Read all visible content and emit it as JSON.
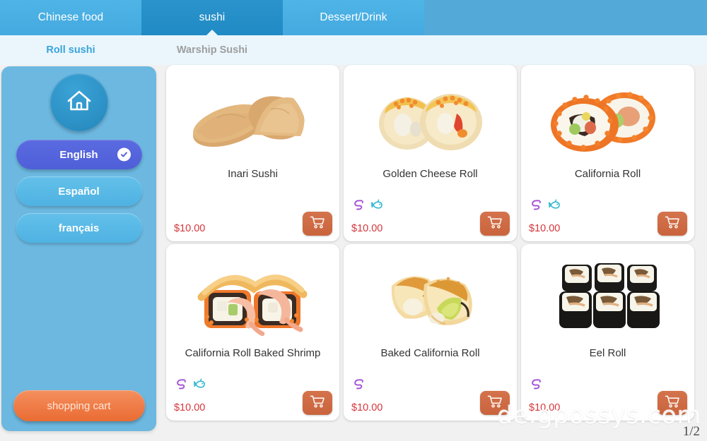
{
  "topbar": {
    "tabs": [
      {
        "label": "Chinese food",
        "active": false
      },
      {
        "label": "sushi",
        "active": true
      },
      {
        "label": "Dessert/Drink",
        "active": false
      }
    ]
  },
  "subbar": {
    "tabs": [
      {
        "label": "Roll sushi",
        "active": true
      },
      {
        "label": "Warship Sushi",
        "active": false
      }
    ]
  },
  "sidebar": {
    "home_icon": "home-icon",
    "languages": [
      {
        "label": "English",
        "selected": true
      },
      {
        "label": "Español",
        "selected": false
      },
      {
        "label": "français",
        "selected": false
      }
    ],
    "cart_label": "shopping cart"
  },
  "products": [
    {
      "name": "Inari Sushi",
      "price": "$10.00",
      "tags": [],
      "add_icon": "shopping-cart-icon"
    },
    {
      "name": "Golden Cheese Roll",
      "price": "$10.00",
      "tags": [
        "shrimp-icon",
        "fish-icon"
      ],
      "add_icon": "shopping-cart-icon"
    },
    {
      "name": "California Roll",
      "price": "$10.00",
      "tags": [
        "shrimp-icon",
        "fish-icon"
      ],
      "add_icon": "shopping-cart-icon"
    },
    {
      "name": "California Roll Baked Shrimp",
      "price": "$10.00",
      "tags": [
        "shrimp-icon",
        "fish-icon"
      ],
      "add_icon": "shopping-cart-icon"
    },
    {
      "name": "Baked California Roll",
      "price": "$10.00",
      "tags": [
        "shrimp-icon"
      ],
      "add_icon": "shopping-cart-icon"
    },
    {
      "name": "Eel Roll",
      "price": "$10.00",
      "tags": [
        "shrimp-icon"
      ],
      "add_icon": "shopping-cart-icon"
    }
  ],
  "footer": {
    "watermark": "de.gpossys.com",
    "page_indicator": "1/2"
  },
  "colors": {
    "tab_active": "#2b93cc",
    "tab_inactive": "#4fb4e6",
    "sidebar": "#6cb8e0",
    "language_selected": "#5a6ae0",
    "cart_orange": "#ef7b46",
    "price_red": "#d4373c",
    "add_button": "#c9643d",
    "shrimp_tag": "#a24fd6",
    "fish_tag": "#2fb8cf"
  }
}
